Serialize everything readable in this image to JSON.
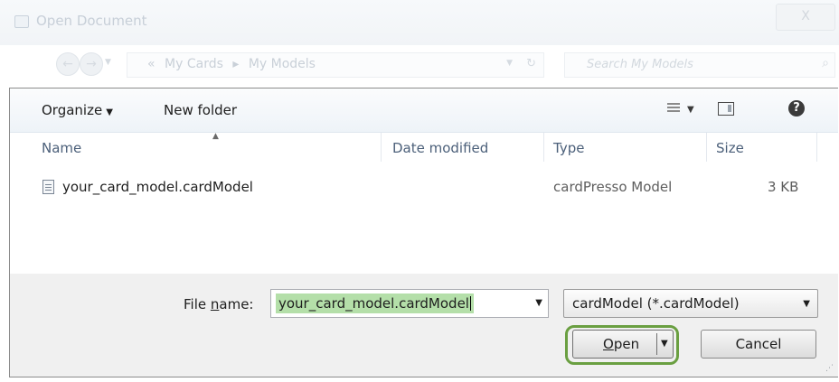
{
  "window": {
    "title": "Open Document",
    "close_glyph": "X"
  },
  "nav": {
    "back_glyph": "←",
    "forward_glyph": "→",
    "crumbs": [
      "«",
      "My Cards",
      "▸",
      "My Models"
    ],
    "search_placeholder": "Search My Models"
  },
  "toolbar": {
    "organize_label": "Organize",
    "new_folder_label": "New folder",
    "help_glyph": "?"
  },
  "columns": {
    "name": "Name",
    "date_modified": "Date modified",
    "type": "Type",
    "size": "Size"
  },
  "files": [
    {
      "name": "your_card_model.cardModel",
      "date_modified": "",
      "type": "cardPresso Model",
      "size": "3 KB"
    }
  ],
  "footer": {
    "file_name_label_pre": "File ",
    "file_name_label_mnemonic": "n",
    "file_name_label_post": "ame:",
    "file_name_value": "your_card_model.cardModel",
    "filter_value": "cardModel (*.cardModel)",
    "open_mnemonic": "O",
    "open_rest": "pen",
    "cancel_label": "Cancel"
  },
  "colors": {
    "highlight_ring": "#6a9f41",
    "filename_selection": "#b4dfa9",
    "header_text": "#4c607a"
  },
  "icons": [
    "app-icon",
    "close-icon",
    "back-icon",
    "forward-icon",
    "refresh-icon",
    "search-icon",
    "views-icon",
    "preview-pane-icon",
    "help-icon",
    "file-icon",
    "resize-grip-icon"
  ]
}
